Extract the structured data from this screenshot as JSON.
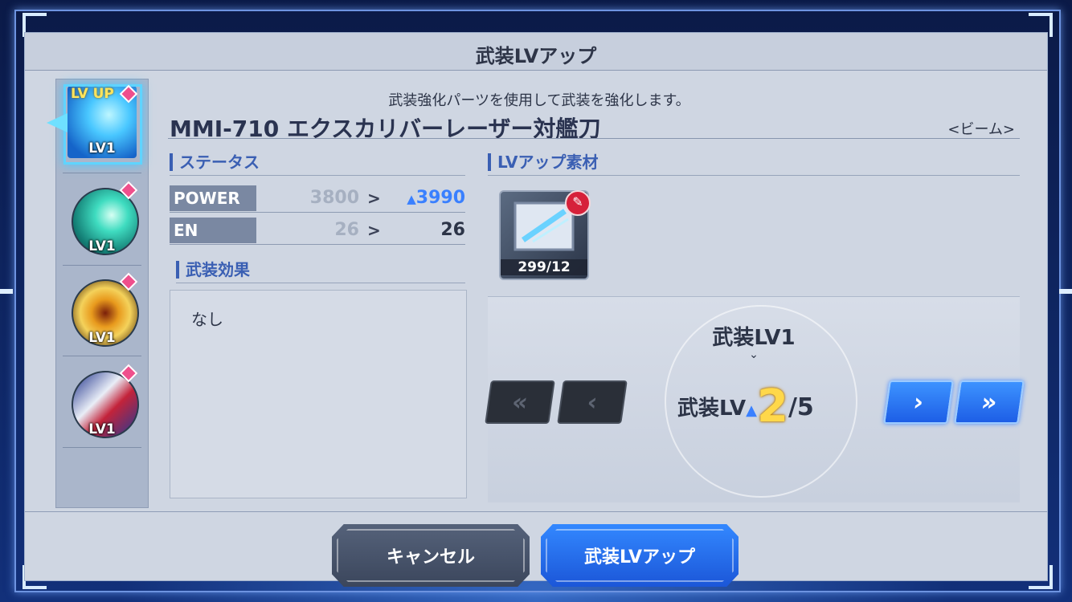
{
  "dialog": {
    "title": "武装LVアップ",
    "subtitle": "武装強化パーツを使用して武装を強化します。"
  },
  "sidebar": {
    "items": [
      {
        "lv_up_tag": "LV UP",
        "level": "LV1",
        "selected": true,
        "icon": "beam-blade-icon"
      },
      {
        "level": "LV1",
        "selected": false,
        "icon": "beam-slash-icon"
      },
      {
        "level": "LV1",
        "selected": false,
        "icon": "explosion-icon"
      },
      {
        "level": "LV1",
        "selected": false,
        "icon": "mobile-suit-portrait-icon"
      }
    ]
  },
  "weapon": {
    "name": "MMI-710 エクスカリバーレーザー対艦刀",
    "type": "<ビーム>"
  },
  "status": {
    "heading": "ステータス",
    "rows": [
      {
        "name": "POWER",
        "old": "3800",
        "arrow": ">",
        "new": "3990",
        "increased": true
      },
      {
        "name": "EN",
        "old": "26",
        "arrow": ">",
        "new": "26",
        "increased": false
      }
    ]
  },
  "effect": {
    "heading": "武装効果",
    "text": "なし"
  },
  "materials": {
    "heading": "LVアップ素材",
    "items": [
      {
        "count": "299/12",
        "icon": "upgrade-part-icon",
        "badge_icon": "feather-badge-icon"
      }
    ]
  },
  "level_select": {
    "current": "武装LV1",
    "down_marker": "⌄",
    "next_label": "武装LV",
    "up_marker": "▲",
    "next_value": "2",
    "max": "/5",
    "buttons": {
      "first": "«",
      "prev": "‹",
      "next": "›",
      "last": "»"
    }
  },
  "actions": {
    "cancel": "キャンセル",
    "confirm": "武装LVアップ"
  },
  "colors": {
    "accent": "#3a80ff",
    "highlight": "#ffd84a",
    "panel": "#cfd6e2"
  }
}
